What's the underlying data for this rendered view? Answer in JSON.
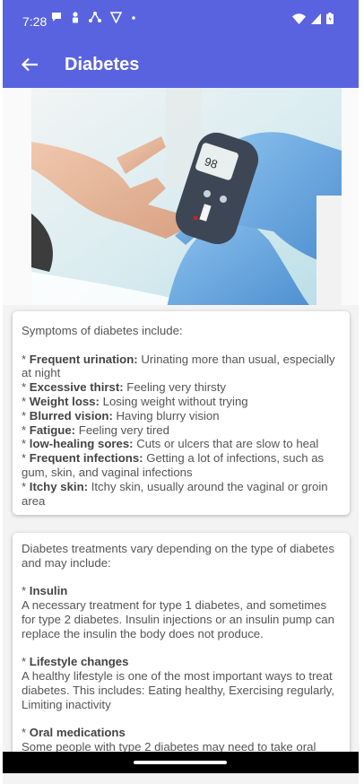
{
  "status_bar": {
    "time": "7:28"
  },
  "app_bar": {
    "title": "Diabetes"
  },
  "colors": {
    "primary": "#5a63df",
    "background": "#f3f3f3"
  },
  "symptoms": {
    "heading": "Symptoms of diabetes include:",
    "items": [
      {
        "name": "Frequent urination:",
        "text": " Urinating more than usual, especially at night"
      },
      {
        "name": "Excessive thirst:",
        "text": " Feeling very thirsty"
      },
      {
        "name": "Weight loss:",
        "text": " Losing weight without trying"
      },
      {
        "name": "Blurred vision:",
        "text": " Having blurry vision"
      },
      {
        "name": "Fatigue:",
        "text": " Feeling very tired"
      },
      {
        "name": "low-healing sores:",
        "text": " Cuts or ulcers that are slow to heal"
      },
      {
        "name": "Frequent infections:",
        "text": " Getting a lot of infections, such as gum, skin, and vaginal infections"
      },
      {
        "name": "Itchy skin:",
        "text": " Itchy skin, usually around the vaginal or groin area"
      }
    ]
  },
  "treatments": {
    "intro": "Diabetes treatments vary depending on the type of diabetes and may include:",
    "items": [
      {
        "name": "Insulin",
        "text": "A necessary treatment for type 1 diabetes, and sometimes for type 2 diabetes. Insulin injections or an insulin pump can replace the insulin the body does not produce."
      },
      {
        "name": "Lifestyle changes",
        "text": "A healthy lifestyle is one of the most important ways to treat diabetes. This includes: Eating healthy, Exercising regularly, Limiting inactivity"
      },
      {
        "name": "Oral medications",
        "text": "Some people with type 2 diabetes may need to take oral"
      }
    ]
  }
}
